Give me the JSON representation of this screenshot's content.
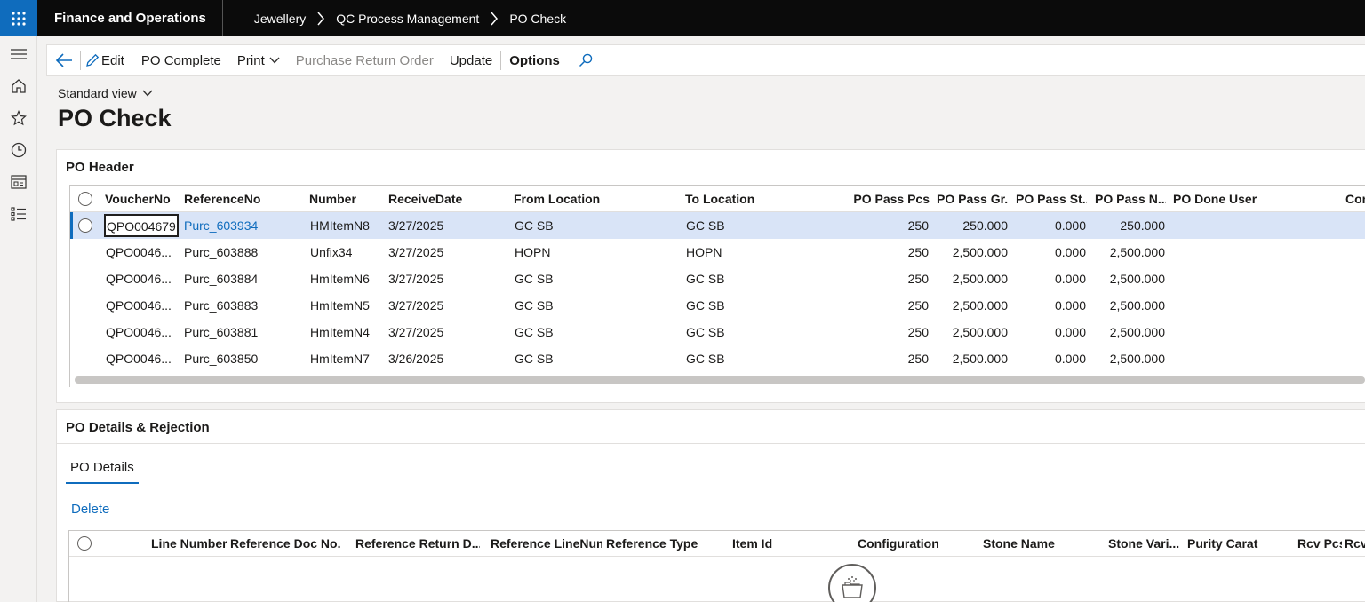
{
  "topbar": {
    "app_title": "Finance and Operations",
    "breadcrumbs": [
      "Jewellery",
      "QC Process Management",
      "PO Check"
    ]
  },
  "actions": {
    "edit": "Edit",
    "po_complete": "PO Complete",
    "print": "Print",
    "purchase_return_order": "Purchase Return Order",
    "update": "Update",
    "options": "Options"
  },
  "view": {
    "selector": "Standard view",
    "title": "PO Check"
  },
  "po_header": {
    "title": "PO Header",
    "columns": [
      "VoucherNo",
      "ReferenceNo",
      "Number",
      "ReceiveDate",
      "From Location",
      "To Location",
      "PO Pass Pcs",
      "PO Pass Gr...",
      "PO Pass St...",
      "PO Pass N...",
      "PO Done User",
      "Con"
    ],
    "rows": [
      [
        "QPO004679",
        "Purc_603934",
        "HMItemN8",
        "3/27/2025",
        "GC SB",
        "GC SB",
        "250",
        "250.000",
        "0.000",
        "250.000"
      ],
      [
        "QPO0046...",
        "Purc_603888",
        "Unfix34",
        "3/27/2025",
        "HOPN",
        "HOPN",
        "250",
        "2,500.000",
        "0.000",
        "2,500.000"
      ],
      [
        "QPO0046...",
        "Purc_603884",
        "HmItemN6",
        "3/27/2025",
        "GC SB",
        "GC SB",
        "250",
        "2,500.000",
        "0.000",
        "2,500.000"
      ],
      [
        "QPO0046...",
        "Purc_603883",
        "HmItemN5",
        "3/27/2025",
        "GC SB",
        "GC SB",
        "250",
        "2,500.000",
        "0.000",
        "2,500.000"
      ],
      [
        "QPO0046...",
        "Purc_603881",
        "HmItemN4",
        "3/27/2025",
        "GC SB",
        "GC SB",
        "250",
        "2,500.000",
        "0.000",
        "2,500.000"
      ],
      [
        "QPO0046...",
        "Purc_603850",
        "HmItemN7",
        "3/26/2025",
        "GC SB",
        "GC SB",
        "250",
        "2,500.000",
        "0.000",
        "2,500.000"
      ]
    ]
  },
  "po_details": {
    "title": "PO Details & Rejection",
    "tab": "PO Details",
    "delete": "Delete",
    "columns": [
      "Line Number",
      "Reference Doc No.",
      "Reference Return D...",
      "Reference LineNum",
      "Reference Type",
      "Item Id",
      "Configuration",
      "Stone Name",
      "Stone Vari...",
      "Purity Carat",
      "Rcv Pcs",
      "Rcv"
    ]
  },
  "colors": {
    "accent": "#0f6cbd",
    "topbar": "#0b0b0b",
    "selected_row": "#d9e4f7"
  }
}
